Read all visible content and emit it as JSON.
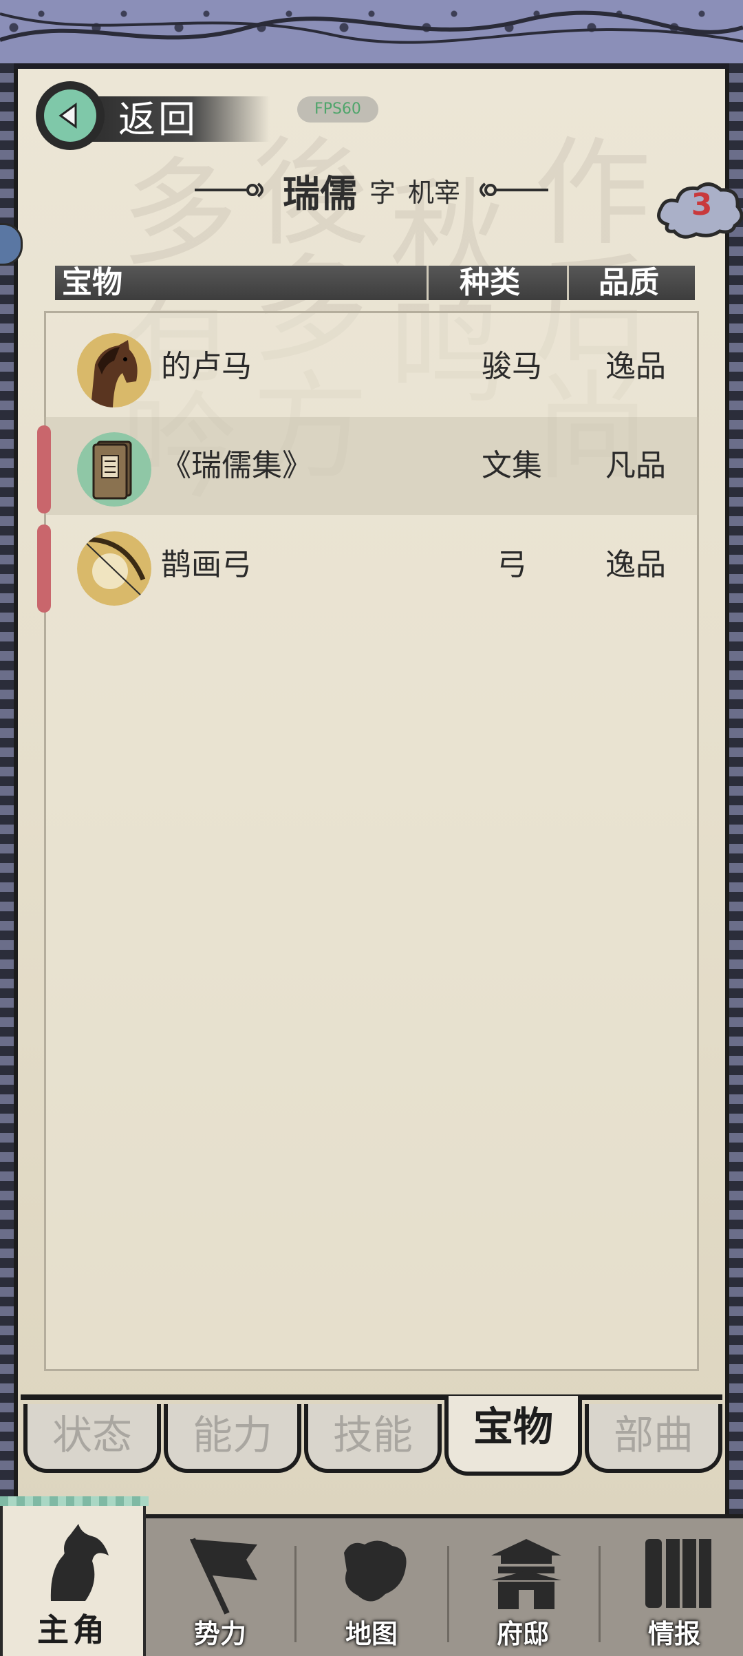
{
  "header": {
    "back_label": "返回",
    "fps_label": "FPS60",
    "character_name": "瑞儒",
    "courtesy_prefix": "字",
    "courtesy_name": "机宰",
    "badge_count": "3"
  },
  "table": {
    "col_item": "宝物",
    "col_type": "种类",
    "col_quality": "品质"
  },
  "items": [
    {
      "name": "的卢马",
      "type": "骏马",
      "quality": "逸品",
      "icon": "horse-icon",
      "marked": false
    },
    {
      "name": "《瑞儒集》",
      "type": "文集",
      "quality": "凡品",
      "icon": "book-icon",
      "marked": true
    },
    {
      "name": "鹊画弓",
      "type": "弓",
      "quality": "逸品",
      "icon": "bow-icon",
      "marked": true
    }
  ],
  "subtabs": [
    {
      "label": "状态",
      "active": false
    },
    {
      "label": "能力",
      "active": false
    },
    {
      "label": "技能",
      "active": false
    },
    {
      "label": "宝物",
      "active": true
    },
    {
      "label": "部曲",
      "active": false
    }
  ],
  "bottom_nav": [
    {
      "label": "主角",
      "icon": "hero-portrait-icon",
      "active": true
    },
    {
      "label": "势力",
      "icon": "flag-icon",
      "active": false
    },
    {
      "label": "地图",
      "icon": "map-icon",
      "active": false
    },
    {
      "label": "府邸",
      "icon": "mansion-icon",
      "active": false
    },
    {
      "label": "情报",
      "icon": "scroll-icon",
      "active": false
    }
  ],
  "colors": {
    "accent_green": "#7fc8a9",
    "marker_red": "#c9666c",
    "badge_red": "#c9393c"
  }
}
